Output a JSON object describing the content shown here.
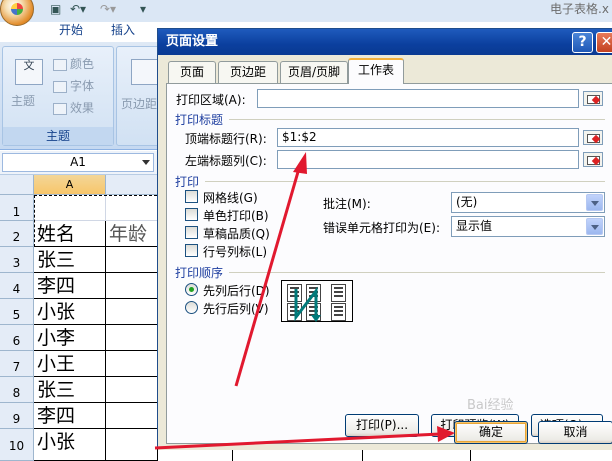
{
  "excel": {
    "tabs": [
      "开始",
      "插入"
    ],
    "doc_title": "电子表格.x",
    "ribbon": {
      "themes_label": "主题",
      "colors_label": "颜色",
      "fonts_label": "字体",
      "effects_label": "效果",
      "margins_label": "页边距",
      "group_label": "主题",
      "theme_icon_text": "文"
    },
    "name_box": "A1",
    "columns": [
      "A"
    ],
    "rows": [
      "1",
      "2",
      "3",
      "4",
      "5",
      "6",
      "7",
      "8",
      "9",
      "10"
    ],
    "cells": {
      "a2": "姓名",
      "b2": "年龄",
      "a3": "张三",
      "a4": "李四",
      "a5": "小张",
      "a6": "小李",
      "a7": "小王",
      "a8": "张三",
      "a9": "李四",
      "a10": "小张"
    }
  },
  "dialog": {
    "title": "页面设置",
    "help_icon": "?",
    "close_icon": "✕",
    "tabs": [
      "页面",
      "页边距",
      "页眉/页脚",
      "工作表"
    ],
    "active_tab": "工作表",
    "print_area_label": "打印区域(A):",
    "print_area_value": "",
    "print_titles_section": "打印标题",
    "top_rows_label": "顶端标题行(R):",
    "top_rows_value": "$1:$2",
    "left_cols_label": "左端标题列(C):",
    "left_cols_value": "",
    "print_section": "打印",
    "gridlines_label": "网格线(G)",
    "mono_label": "单色打印(B)",
    "draft_label": "草稿品质(Q)",
    "headings_label": "行号列标(L)",
    "comments_label": "批注(M):",
    "comments_value": "(无)",
    "errors_label": "错误单元格打印为(E):",
    "errors_value": "显示值",
    "order_section": "打印顺序",
    "down_then_over": "先列后行(D)",
    "over_then_down": "先行后列(V)",
    "selected_order": "先列后行(D)",
    "print_button": "打印(P)...",
    "preview_button": "打印预览(W)",
    "options_button": "选项(O)...",
    "ok_button": "确定",
    "cancel_button": "取消",
    "watermark": "Bai经验"
  },
  "colors": {
    "title_bar": "#0b3f9e",
    "arrow": "#e1192f",
    "selected_radio": "#21a121",
    "active_tab_top": "#f4b13b"
  }
}
